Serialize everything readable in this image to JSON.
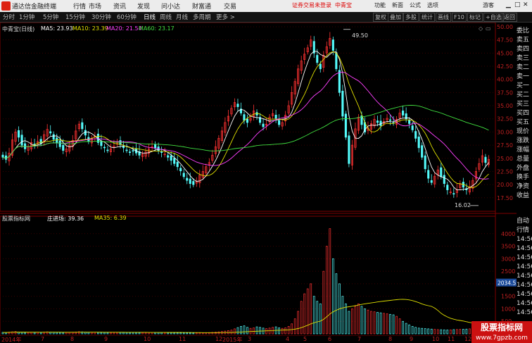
{
  "titlebar": {
    "app_title": "通达信金融终端",
    "menu": [
      "行情",
      "市场",
      "资讯",
      "发现",
      "问小达",
      "财富通",
      "交易"
    ],
    "warning": "证券交易未登录",
    "stock": "中青宝",
    "right_menu": [
      "功能",
      "新面",
      "公式",
      "选项",
      "游客"
    ]
  },
  "toolbar": {
    "periods": [
      "分时",
      "1分钟",
      "5分钟",
      "15分钟",
      "30分钟",
      "60分钟",
      "日线",
      "周线",
      "月线",
      "多周期",
      "更多 >"
    ],
    "active_period": "日线",
    "buttons": [
      "复权",
      "叠加",
      "多股",
      "统计",
      "画线",
      "F10",
      "标记",
      "+自选",
      "返回"
    ]
  },
  "main_chart": {
    "stock_label": "中青宝(日线)",
    "ma": [
      {
        "label": "MA5: 23.93",
        "color": "#ffffff"
      },
      {
        "label": "MA10: 23.39",
        "color": "#e0e000"
      },
      {
        "label": "MA20: 21.54",
        "color": "#ff40ff"
      },
      {
        "label": "MA60: 23.17",
        "color": "#40e040"
      }
    ],
    "high_label": "49.50",
    "low_label": "16.02",
    "price_ticks": [
      "50.00",
      "47.50",
      "45.00",
      "42.50",
      "40.00",
      "37.50",
      "35.00",
      "32.50",
      "30.00",
      "27.50",
      "25.00",
      "22.50",
      "20.00",
      "17.50"
    ]
  },
  "indicator": {
    "name": "股票指标网",
    "label1": "庄进场: 39.36",
    "label2": "MA35: 6.39",
    "ticks": [
      "4000",
      "3500",
      "3000",
      "2500",
      "2000",
      "1500",
      "1000",
      "500"
    ],
    "current": "2034.52"
  },
  "sidebar_top": [
    "委比",
    "卖五",
    "卖四",
    "卖三",
    "卖二",
    "卖一",
    "买一",
    "买二",
    "买三",
    "买四",
    "买五",
    "现价",
    "涨跌",
    "涨幅",
    "总量",
    "外盘",
    "换手",
    "净资",
    "收益"
  ],
  "sidebar_bottom": [
    "自动",
    "行情",
    "14:56",
    "14:56",
    "14:56",
    "14:56",
    "14:56",
    "14:56",
    "14:56",
    "14:56",
    "14:56"
  ],
  "dates": [
    "2014年",
    "7",
    "8",
    "9",
    "10",
    "11",
    "12",
    "2015年",
    "3",
    "4",
    "5",
    "6",
    "7",
    "8",
    "9",
    "10",
    "11",
    "12",
    "2"
  ],
  "watermark": {
    "line1": "股票指标网",
    "line2": "www.7gpzb.com"
  },
  "colors": {
    "up": "#ff3232",
    "down": "#54fcfc",
    "grid": "#5a0000"
  },
  "chart_data": {
    "type": "candlestick",
    "price_range": [
      16.0,
      50.0
    ],
    "high": 49.5,
    "low": 16.02,
    "closes": [
      25.2,
      24.8,
      26.0,
      28.5,
      30.0,
      29.0,
      27.5,
      26.8,
      27.2,
      28.0,
      27.5,
      28.2,
      27.8,
      29.5,
      30.5,
      29.8,
      28.6,
      27.9,
      27.2,
      26.5,
      26.8,
      27.5,
      28.4,
      30.2,
      31.5,
      30.6,
      29.4,
      28.2,
      28.8,
      29.2,
      28.0,
      27.4,
      27.0,
      26.5,
      26.8,
      27.3,
      28.1,
      27.6,
      27.0,
      26.5,
      26.2,
      26.4,
      26.0,
      25.6,
      25.8,
      26.2,
      26.8,
      27.2,
      26.9,
      26.5,
      26.1,
      25.8,
      25.2,
      24.6,
      24.0,
      23.4,
      22.6,
      21.5,
      20.8,
      20.2,
      20.0,
      20.6,
      21.8,
      22.5,
      23.4,
      24.2,
      25.6,
      27.2,
      28.8,
      30.2,
      31.8,
      33.0,
      34.5,
      35.6,
      34.8,
      33.6,
      32.2,
      31.8,
      32.6,
      34.0,
      33.2,
      31.8,
      31.0,
      31.5,
      32.8,
      33.5,
      32.6,
      31.4,
      31.8,
      33.2,
      35.0,
      37.5,
      39.6,
      42.0,
      43.5,
      44.8,
      46.0,
      47.5,
      45.0,
      43.2,
      42.0,
      44.6,
      46.2,
      47.8,
      45.5,
      42.0,
      37.5,
      33.0,
      29.0,
      24.0,
      27.5,
      30.6,
      32.8,
      31.4,
      30.0,
      30.8,
      31.6,
      32.4,
      31.8,
      31.2,
      32.0,
      32.6,
      32.2,
      31.7,
      32.4,
      33.6,
      33.2,
      32.5,
      31.6,
      30.4,
      28.8,
      27.0,
      25.2,
      23.0,
      21.2,
      20.4,
      21.6,
      22.8,
      21.5,
      20.2,
      19.0,
      18.6,
      18.2,
      19.0,
      20.2,
      19.5,
      19.0,
      19.6,
      20.8,
      22.5,
      24.0,
      25.5,
      24.2,
      24.8
    ],
    "volumes": [
      60,
      55,
      70,
      80,
      90,
      75,
      65,
      60,
      58,
      62,
      60,
      64,
      58,
      70,
      80,
      72,
      66,
      60,
      58,
      55,
      57,
      60,
      66,
      75,
      85,
      78,
      70,
      62,
      64,
      66,
      60,
      56,
      54,
      52,
      53,
      56,
      60,
      58,
      55,
      52,
      50,
      52,
      50,
      48,
      49,
      51,
      54,
      56,
      54,
      52,
      50,
      48,
      46,
      44,
      42,
      40,
      38,
      36,
      35,
      34,
      34,
      36,
      40,
      44,
      48,
      52,
      60,
      70,
      80,
      95,
      110,
      130,
      150,
      200,
      250,
      300,
      320,
      260,
      220,
      240,
      280,
      260,
      230,
      210,
      230,
      260,
      280,
      240,
      220,
      240,
      300,
      400,
      600,
      900,
      1300,
      1600,
      1800,
      2000,
      1500,
      1300,
      1200,
      2500,
      3500,
      4200,
      3000,
      2400,
      2000,
      1500,
      1200,
      900,
      1000,
      1100,
      1200,
      1100,
      1000,
      950,
      900,
      880,
      860,
      840,
      820,
      800,
      780,
      760,
      700,
      600,
      500,
      420,
      360,
      300,
      260,
      230,
      220,
      210,
      200,
      190,
      180,
      170,
      165,
      160,
      155,
      160,
      170,
      175,
      180,
      185,
      190,
      200,
      210,
      220,
      215,
      210
    ]
  }
}
